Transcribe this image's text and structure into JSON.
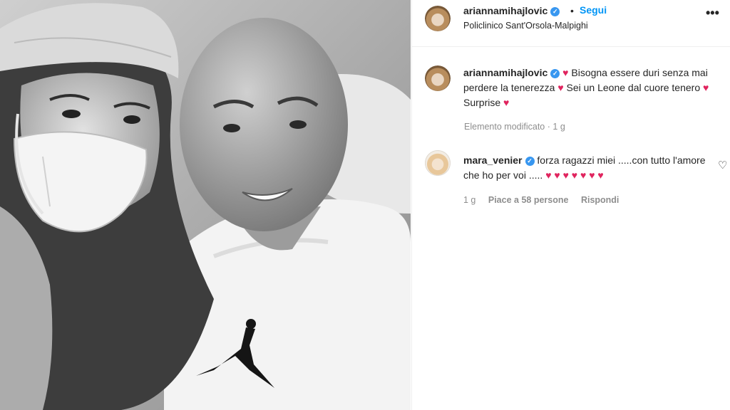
{
  "post": {
    "username": "ariannamihajlovic",
    "separator": "•",
    "follow_label": "Segui",
    "location": "Policlinico Sant'Orsola-Malpighi",
    "more_icon": "more-horizontal-icon"
  },
  "caption": {
    "username": "ariannamihajlovic",
    "segments": [
      "Bisogna essere duri senza mai perdere la tenerezza",
      "Sei un Leone dal cuore tenero",
      "Surprise"
    ],
    "edited_label": "Elemento modificato",
    "time": "1 g"
  },
  "comment": {
    "username": "mara_venier",
    "text": "forza ragazzi miei .....con tutto l'amore che ho per voi .....",
    "hearts": "♥ ♥ ♥ ♥ ♥ ♥ ♥",
    "time": "1 g",
    "likes_label": "Piace a 58 persone",
    "reply_label": "Rispondi"
  },
  "icons": {
    "verified": "✓",
    "heart": "♥",
    "like_outline": "♡",
    "more": "•••"
  },
  "colors": {
    "link_blue": "#0095f6",
    "verified_blue": "#3897f0",
    "heart_red": "#e0245e",
    "muted": "#8e8e8e"
  }
}
